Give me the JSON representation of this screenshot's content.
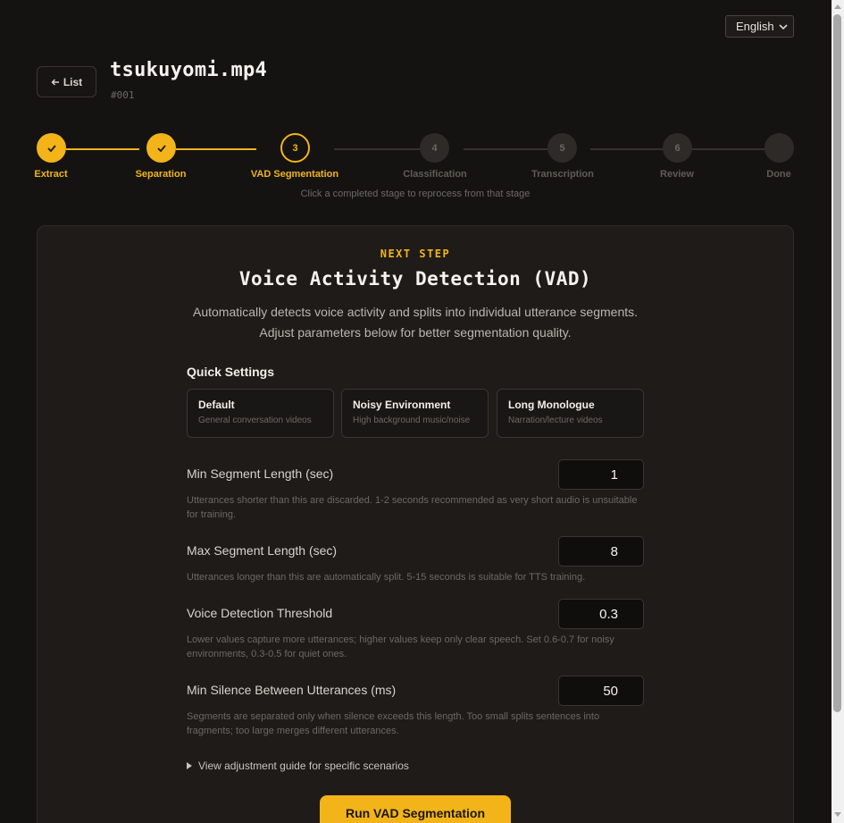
{
  "language": {
    "selected": "English"
  },
  "header": {
    "back_label": "List",
    "file_title": "tsukuyomi.mp4",
    "file_id": "#001"
  },
  "stepper": {
    "steps": [
      {
        "number": "",
        "label": "Extract",
        "state": "done"
      },
      {
        "number": "",
        "label": "Separation",
        "state": "done"
      },
      {
        "number": "3",
        "label": "VAD Segmentation",
        "state": "active"
      },
      {
        "number": "4",
        "label": "Classification",
        "state": "todo"
      },
      {
        "number": "5",
        "label": "Transcription",
        "state": "todo"
      },
      {
        "number": "6",
        "label": "Review",
        "state": "todo"
      },
      {
        "number": "",
        "label": "Done",
        "state": "todo"
      }
    ],
    "hint": "Click a completed stage to reprocess from that stage"
  },
  "card": {
    "eyebrow": "NEXT STEP",
    "title": "Voice Activity Detection (VAD)",
    "desc_line1": "Automatically detects voice activity and splits into individual utterance segments.",
    "desc_line2": "Adjust parameters below for better segmentation quality."
  },
  "quick_settings": {
    "title": "Quick Settings",
    "presets": [
      {
        "name": "Default",
        "sub": "General conversation videos"
      },
      {
        "name": "Noisy Environment",
        "sub": "High background music/noise"
      },
      {
        "name": "Long Monologue",
        "sub": "Narration/lecture videos"
      }
    ]
  },
  "params": [
    {
      "label": "Min Segment Length (sec)",
      "value": "1",
      "help": "Utterances shorter than this are discarded. 1-2 seconds recommended as very short audio is unsuitable for training."
    },
    {
      "label": "Max Segment Length (sec)",
      "value": "8",
      "help": "Utterances longer than this are automatically split. 5-15 seconds is suitable for TTS training."
    },
    {
      "label": "Voice Detection Threshold",
      "value": "0.3",
      "help": "Lower values capture more utterances; higher values keep only clear speech. Set 0.6-0.7 for noisy environments, 0.3-0.5 for quiet ones."
    },
    {
      "label": "Min Silence Between Utterances (ms)",
      "value": "50",
      "help": "Segments are separated only when silence exceeds this length. Too small splits sentences into fragments; too large merges different utterances."
    }
  ],
  "guide_label": "View adjustment guide for specific scenarios",
  "run_button": "Run VAD Segmentation",
  "colors": {
    "accent": "#f2b418",
    "background": "#151312",
    "card": "#1e1b19"
  }
}
